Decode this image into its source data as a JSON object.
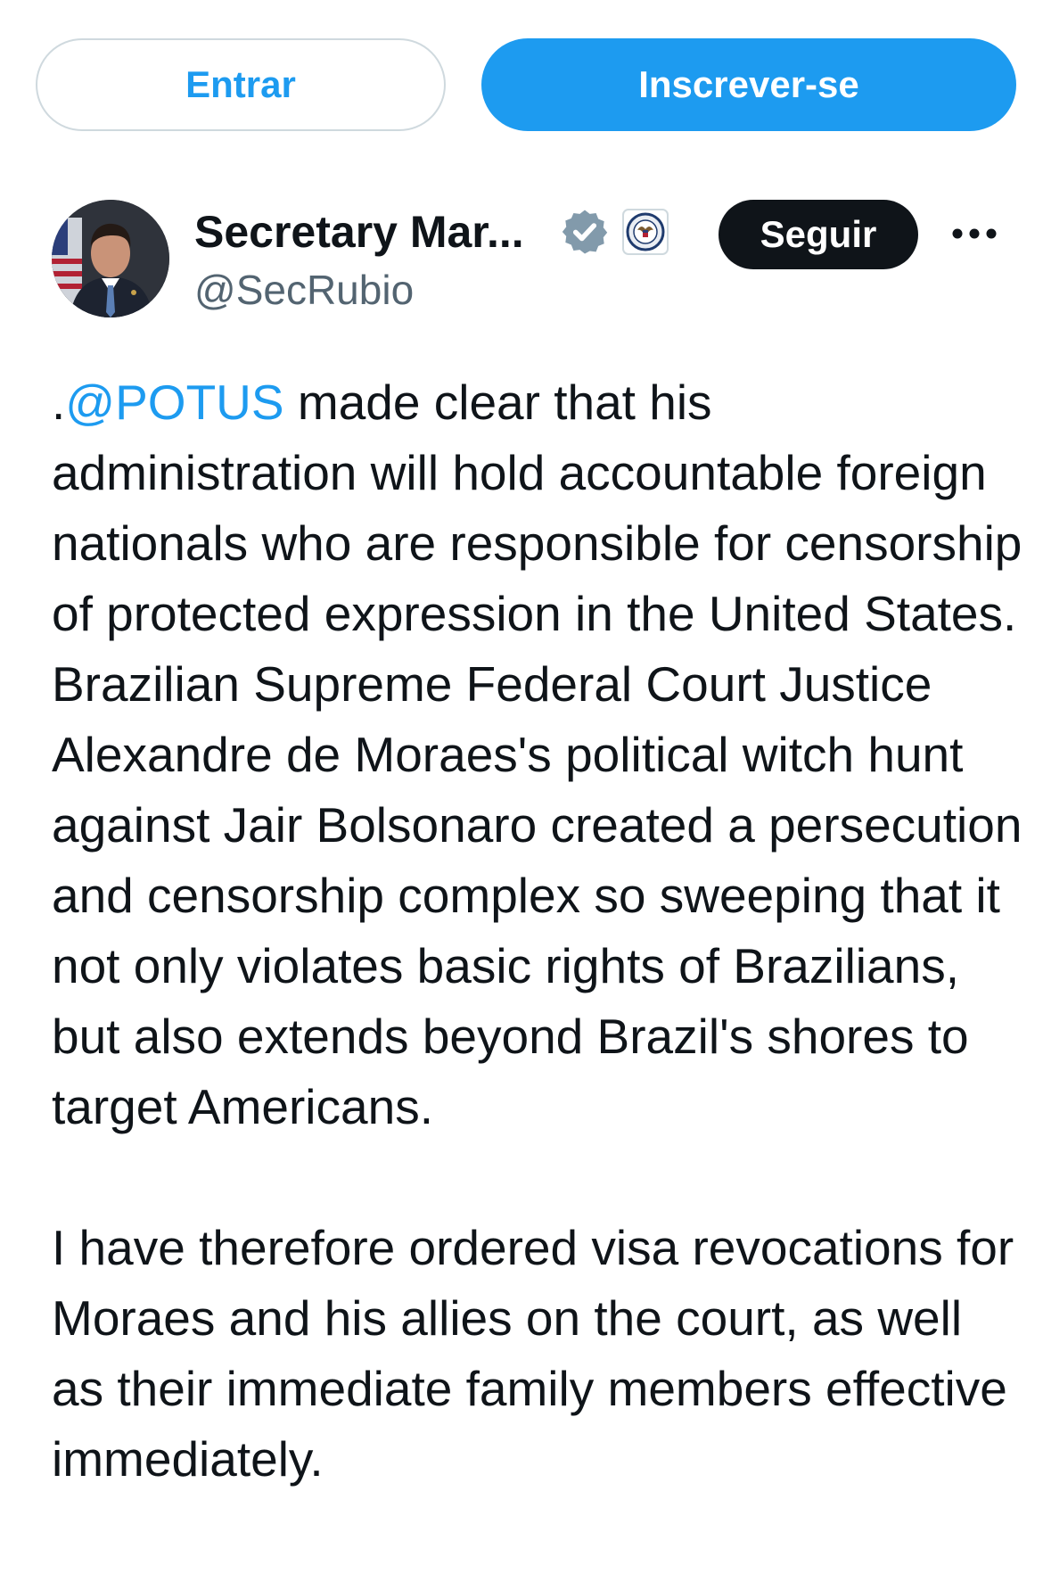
{
  "topbar": {
    "login_label": "Entrar",
    "signup_label": "Inscrever-se"
  },
  "author": {
    "display_name": "Secretary Mar...",
    "handle": "@SecRubio",
    "verified_icon": "verified-badge-icon",
    "affiliation_icon": "state-department-seal-icon",
    "avatar": "avatar-photo"
  },
  "actions": {
    "follow_label": "Seguir",
    "more_icon": "more-dots-icon"
  },
  "tweet": {
    "line1_prefix": ".",
    "mention": "@POTUS",
    "line1_rest": " made clear that his",
    "para1_rest": "administration will hold accountable foreign nationals who are responsible for censorship of protected expression in the United States. Brazilian Supreme Federal Court Justice Alexandre de Moraes's political witch hunt against Jair Bolsonaro created a persecution and censorship complex so sweeping that it not only violates basic rights of Brazilians, but also extends beyond Brazil's shores to target Americans.",
    "para2": "I have therefore ordered visa revocations for Moraes and his allies on the court, as well as their immediate family members effective immediately."
  },
  "colors": {
    "accent": "#1d9bf0",
    "text": "#0f1419",
    "secondary_text": "#536471",
    "border": "#cfd9de",
    "verified_badge": "#829aab"
  }
}
